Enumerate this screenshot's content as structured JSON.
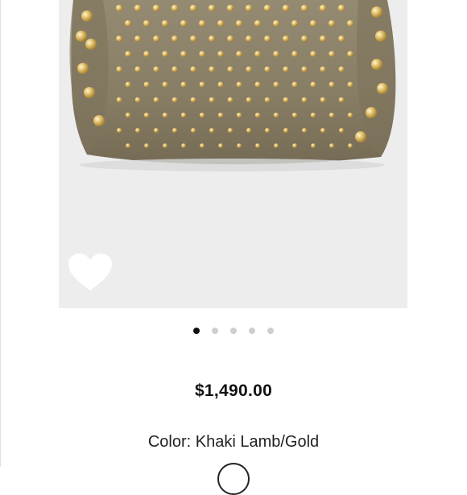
{
  "product": {
    "image_alt": "Studded khaki leather bag",
    "like_icon": "heart-icon",
    "price": "$1,490.00",
    "color_label": "Color:",
    "color_value": "Khaki Lamb/Gold"
  },
  "carousel": {
    "total": 5,
    "active_index": 0
  },
  "colors": {
    "accent": "#111111",
    "dot_inactive": "#cfcfcf",
    "image_background": "#ededed",
    "bag_leather": "#8b8068",
    "stud_gold": "#d6b05a"
  }
}
